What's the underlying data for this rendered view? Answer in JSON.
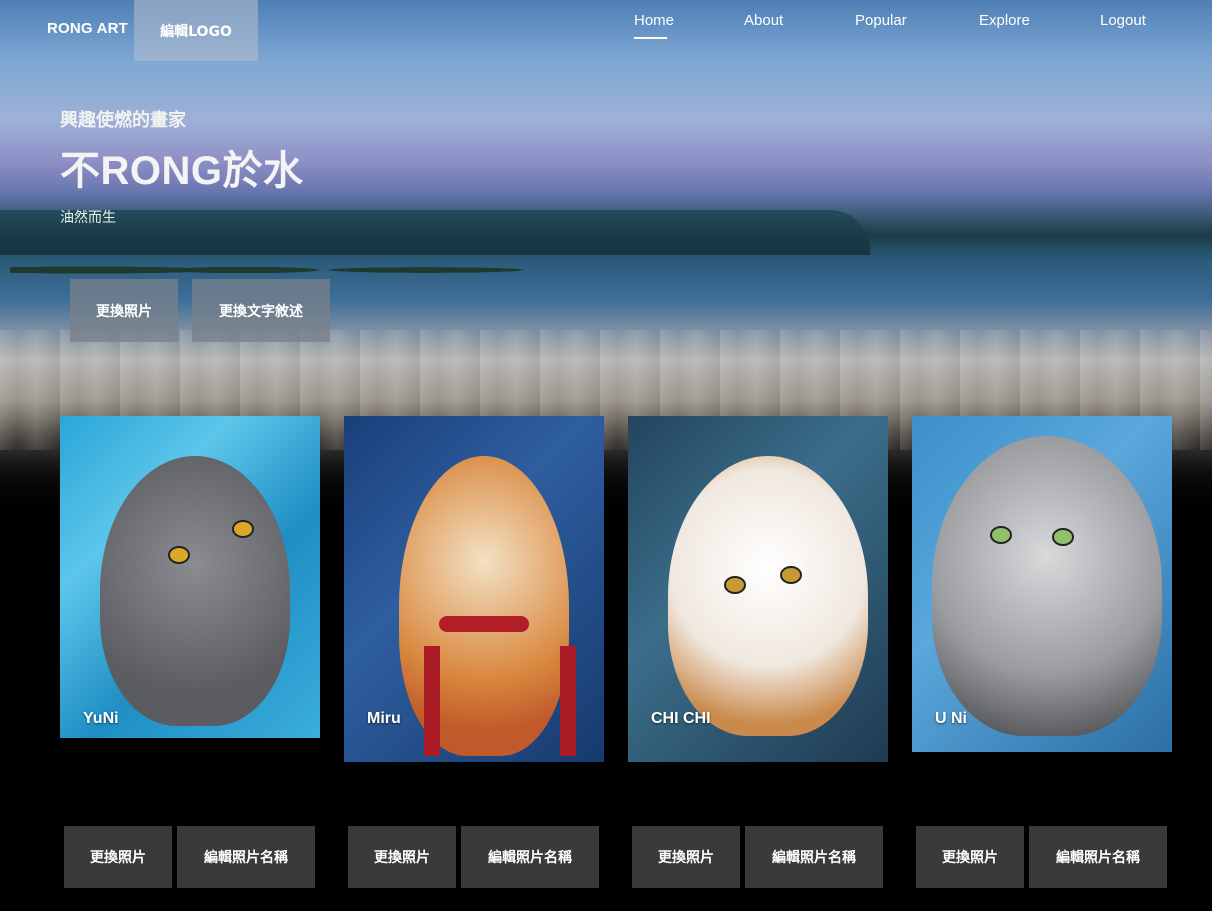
{
  "brand": "RONG ART",
  "edit_logo_label": "編輯LOGO",
  "nav": {
    "home": "Home",
    "about": "About",
    "popular": "Popular",
    "explore": "Explore",
    "logout": "Logout",
    "active": "Home"
  },
  "hero": {
    "subtitle": "興趣使燃的畫家",
    "title": "不RONG於水",
    "description": "油然而生",
    "change_photo_label": "更換照片",
    "change_text_label": "更換文字敘述"
  },
  "cards": [
    {
      "name": "YuNi",
      "change_photo_label": "更換照片",
      "edit_name_label": "編輯照片名稱"
    },
    {
      "name": "Miru",
      "change_photo_label": "更換照片",
      "edit_name_label": "編輯照片名稱"
    },
    {
      "name": "CHI CHI",
      "change_photo_label": "更換照片",
      "edit_name_label": "編輯照片名稱"
    },
    {
      "name": "U Ni",
      "change_photo_label": "更換照片",
      "edit_name_label": "編輯照片名稱"
    }
  ],
  "colors": {
    "background": "#000000",
    "button_dark": "#3a3a3a",
    "hero_button": "#78808a",
    "text": "#ffffff"
  }
}
